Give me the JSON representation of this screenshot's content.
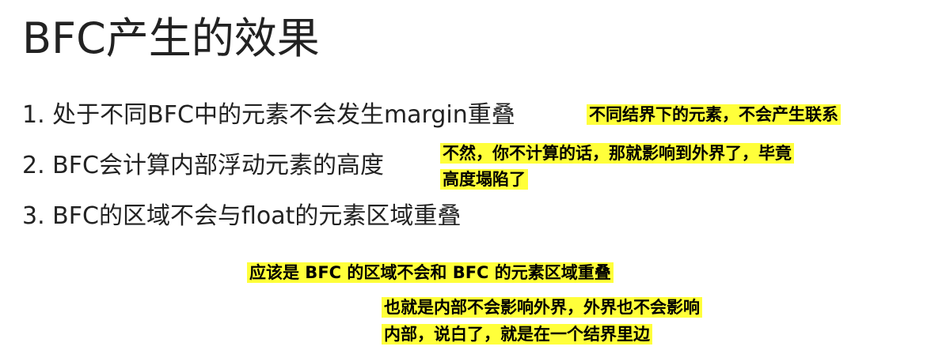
{
  "slide": {
    "title": "BFC产生的效果",
    "points": [
      "1. 处于不同BFC中的元素不会发生margin重叠",
      "2. BFC会计算内部浮动元素的高度",
      "3. BFC的区域不会与float的元素区域重叠"
    ]
  },
  "annotations": {
    "note1": "不同结界下的元素，不会产生联系",
    "note2_line1": "不然，你不计算的话，那就影响到外界了，毕竟",
    "note2_line2": "高度塌陷了",
    "note3": "应该是 BFC 的区域不会和 BFC 的元素区域重叠",
    "note4_line1": "也就是内部不会影响外界，外界也不会影响",
    "note4_line2": "内部，说白了，就是在一个结界里边"
  },
  "colors": {
    "highlight": "#ffff3a",
    "text": "#222222"
  }
}
